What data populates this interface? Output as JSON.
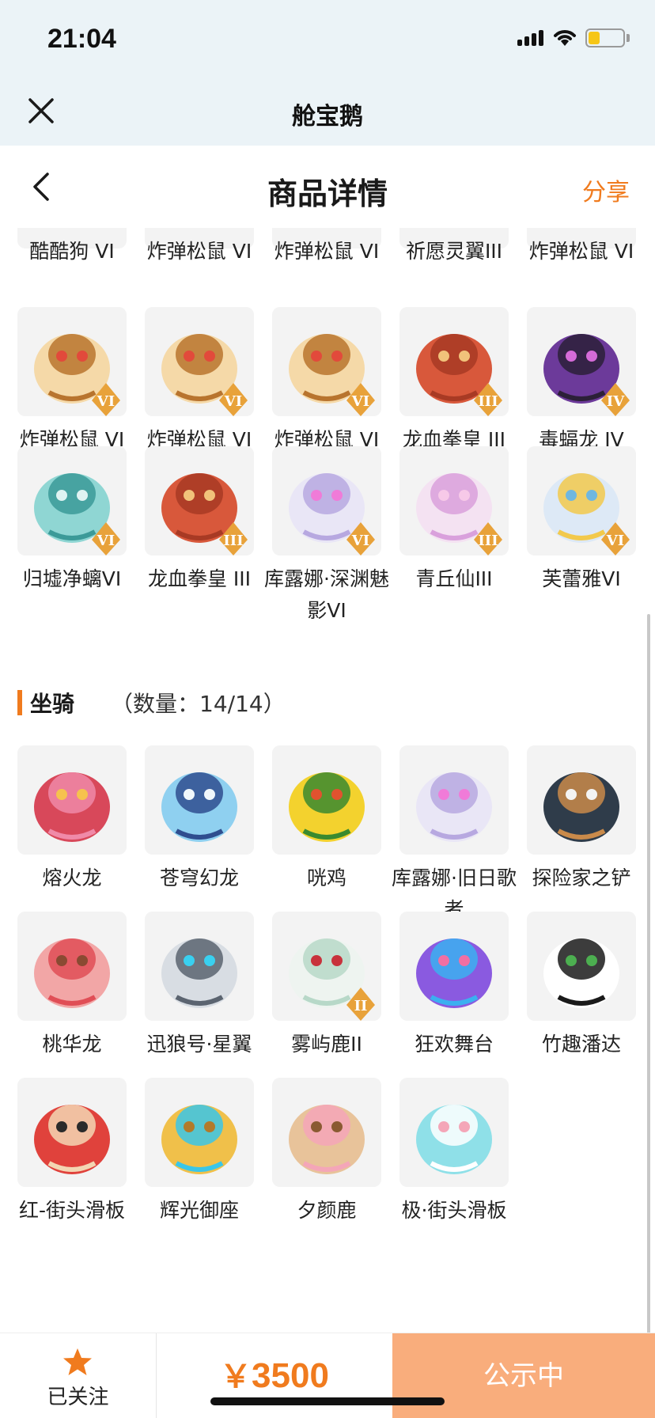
{
  "status_bar": {
    "time": "21:04"
  },
  "app_bar": {
    "title": "舱宝鹅"
  },
  "nav": {
    "title": "商品详情",
    "share": "分享"
  },
  "skins_partial": [
    {
      "name": "酷酷狗 VI",
      "icon": "dog-icon"
    },
    {
      "name": "炸弹松鼠 VI",
      "icon": "squirrel-icon"
    },
    {
      "name": "炸弹松鼠 VI",
      "icon": "squirrel-icon"
    },
    {
      "name": "祈愿灵翼III",
      "icon": "wing-icon"
    },
    {
      "name": "炸弹松鼠 VI",
      "icon": "squirrel-icon"
    }
  ],
  "skins": [
    {
      "name": "炸弹松鼠 VI",
      "icon": "squirrel-icon",
      "tier": "VI"
    },
    {
      "name": "炸弹松鼠 VI",
      "icon": "squirrel-icon",
      "tier": "VI"
    },
    {
      "name": "炸弹松鼠 VI",
      "icon": "squirrel-icon",
      "tier": "VI"
    },
    {
      "name": "龙血拳皇 III",
      "icon": "ram-icon",
      "tier": "III"
    },
    {
      "name": "毒蝠龙 IV",
      "icon": "bat-dragon-icon",
      "tier": "IV"
    },
    {
      "name": "归墟净螭VI",
      "icon": "water-dragon-icon",
      "tier": "VI"
    },
    {
      "name": "龙血拳皇 III",
      "icon": "ram-icon",
      "tier": "III"
    },
    {
      "name": "库露娜·深渊魅影VI",
      "icon": "girl-icon",
      "tier": "VI"
    },
    {
      "name": "青丘仙III",
      "icon": "fox-girl-icon",
      "tier": "III"
    },
    {
      "name": "芙蕾雅VI",
      "icon": "valkyrie-icon",
      "tier": "VI"
    }
  ],
  "mounts_section": {
    "title": "坐骑",
    "count": "（数量：14/14）"
  },
  "mounts": [
    {
      "name": "熔火龙",
      "icon": "fire-dragon-icon"
    },
    {
      "name": "苍穹幻龙",
      "icon": "sky-dragon-icon"
    },
    {
      "name": "咣鸡",
      "icon": "chicken-icon"
    },
    {
      "name": "库露娜·旧日歌者",
      "icon": "girl-icon"
    },
    {
      "name": "探险家之铲",
      "icon": "shovel-icon"
    },
    {
      "name": "桃华龙",
      "icon": "peach-dragon-icon"
    },
    {
      "name": "迅狼号·星翼",
      "icon": "mech-wolf-icon"
    },
    {
      "name": "雾屿鹿II",
      "icon": "deer-icon",
      "tier": "II"
    },
    {
      "name": "狂欢舞台",
      "icon": "stage-icon"
    },
    {
      "name": "竹趣潘达",
      "icon": "panda-icon"
    },
    {
      "name": "红-街头滑板",
      "icon": "skateboard-red-icon"
    },
    {
      "name": "辉光御座",
      "icon": "throne-icon"
    },
    {
      "name": "夕颜鹿",
      "icon": "deer-blossom-icon"
    },
    {
      "name": "极·街头滑板",
      "icon": "skateboard-blue-icon"
    }
  ],
  "bottom_bar": {
    "follow_label": "已关注",
    "price_symbol": "￥",
    "price_value": "3500",
    "status_label": "公示中"
  },
  "colors": {
    "accent": "#f07b1e",
    "status_button": "#f9ad7c",
    "header_bg": "#ebf3f7"
  }
}
